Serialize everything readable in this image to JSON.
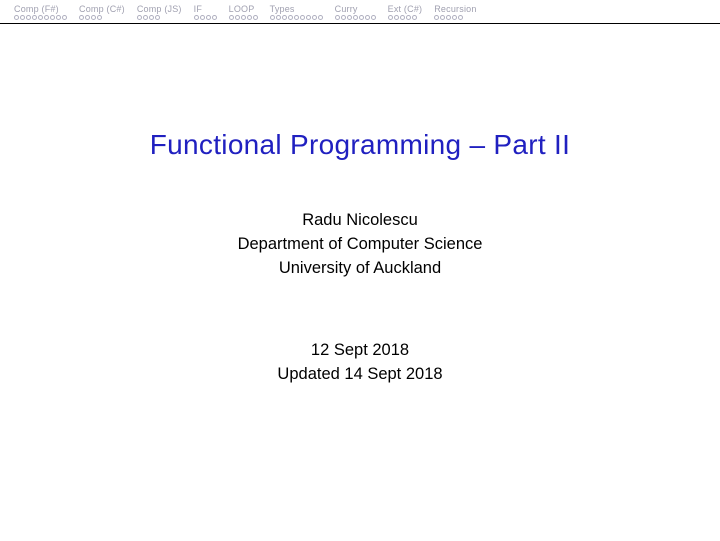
{
  "nav": {
    "sections": [
      {
        "label": "Comp (F#)",
        "slides": 9
      },
      {
        "label": "Comp (C#)",
        "slides": 4
      },
      {
        "label": "Comp (JS)",
        "slides": 4
      },
      {
        "label": "IF",
        "slides": 4
      },
      {
        "label": "LOOP",
        "slides": 5
      },
      {
        "label": "Types",
        "slides": 9
      },
      {
        "label": "Curry",
        "slides": 7
      },
      {
        "label": "Ext (C#)",
        "slides": 5
      },
      {
        "label": "Recursion",
        "slides": 5
      }
    ]
  },
  "title": "Functional Programming – Part II",
  "author": {
    "name": "Radu Nicolescu",
    "department": "Department of Computer Science",
    "university": "University of Auckland"
  },
  "date": {
    "main": "12 Sept 2018",
    "updated": "Updated 14 Sept 2018"
  }
}
